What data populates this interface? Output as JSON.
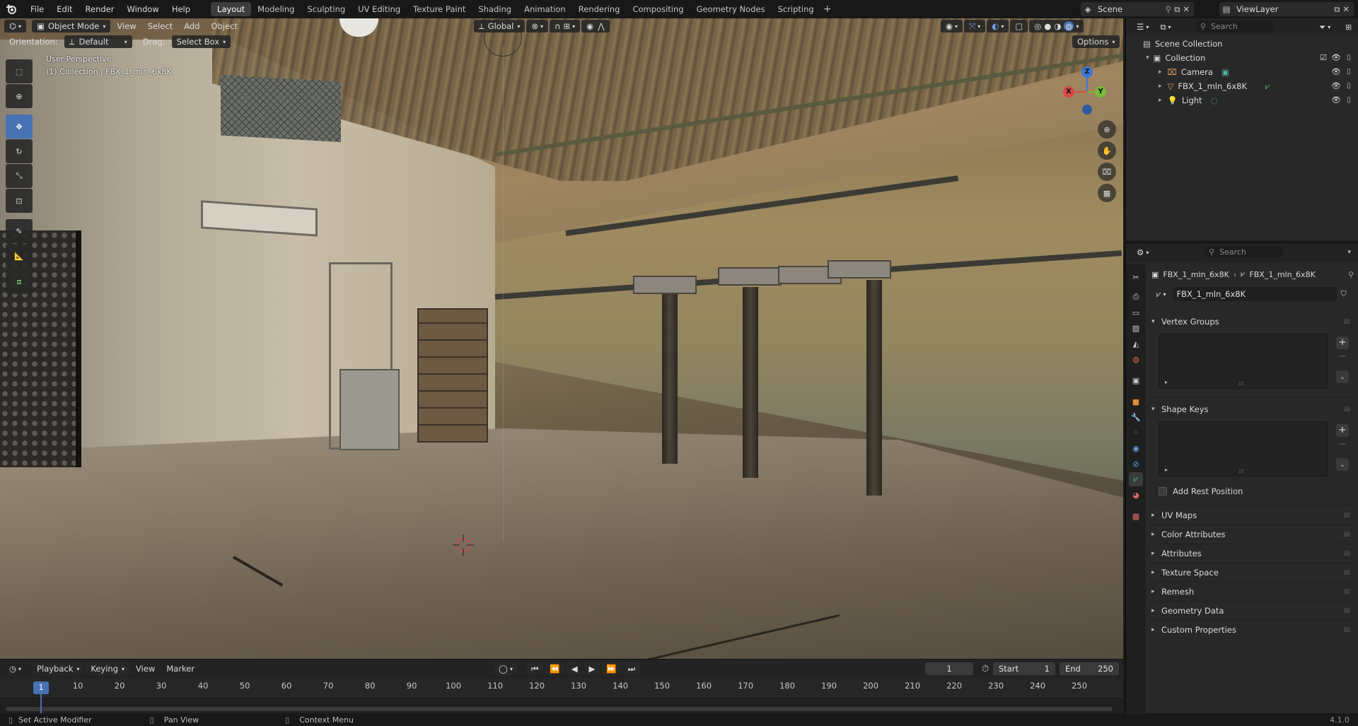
{
  "menubar": {
    "items": [
      "File",
      "Edit",
      "Render",
      "Window",
      "Help"
    ],
    "workspaces": [
      "Layout",
      "Modeling",
      "Sculpting",
      "UV Editing",
      "Texture Paint",
      "Shading",
      "Animation",
      "Rendering",
      "Compositing",
      "Geometry Nodes",
      "Scripting"
    ],
    "active_workspace": "Layout",
    "add_tab": "+",
    "scene": "Scene",
    "view_layer": "ViewLayer"
  },
  "viewport": {
    "mode": "Object Mode",
    "menus": [
      "View",
      "Select",
      "Add",
      "Object"
    ],
    "orientation_label": "Orientation:",
    "orientation_value": "Default",
    "drag_label": "Drag:",
    "drag_value": "Select Box",
    "transform_orientation": "Global",
    "options": "Options",
    "info_line1": "User Perspective",
    "info_line2": "(1) Collection | FBX_1_mln_6x8K",
    "gizmo": {
      "z": "Z",
      "x": "X",
      "y": "Y"
    }
  },
  "timeline": {
    "menus": [
      "Playback",
      "Keying",
      "View",
      "Marker"
    ],
    "current_frame": "1",
    "start_label": "Start",
    "start_value": "1",
    "end_label": "End",
    "end_value": "250",
    "ticks": [
      "1",
      "10",
      "20",
      "30",
      "40",
      "50",
      "60",
      "70",
      "80",
      "90",
      "100",
      "110",
      "120",
      "130",
      "140",
      "150",
      "160",
      "170",
      "180",
      "190",
      "200",
      "210",
      "220",
      "230",
      "240",
      "250"
    ]
  },
  "statusbar": {
    "hint1": "Set Active Modifier",
    "hint2": "Pan View",
    "hint3": "Context Menu",
    "version": "4.1.0"
  },
  "outliner": {
    "search_placeholder": "Search",
    "scene_collection": "Scene Collection",
    "collection": "Collection",
    "items": [
      "Camera",
      "FBX_1_mln_6x8K",
      "Light"
    ]
  },
  "properties": {
    "search_placeholder": "Search",
    "breadcrumb_object": "FBX_1_mln_6x8K",
    "breadcrumb_data": "FBX_1_mln_6x8K",
    "mesh_name": "FBX_1_mln_6x8K",
    "vertex_groups": "Vertex Groups",
    "shape_keys": "Shape Keys",
    "add_rest_position": "Add Rest Position",
    "uv_maps": "UV Maps",
    "color_attributes": "Color Attributes",
    "attributes": "Attributes",
    "texture_space": "Texture Space",
    "remesh": "Remesh",
    "geometry_data": "Geometry Data",
    "custom_properties": "Custom Properties"
  },
  "colors": {
    "accent": "#4772b3",
    "panel": "#282828",
    "header": "#181818"
  }
}
